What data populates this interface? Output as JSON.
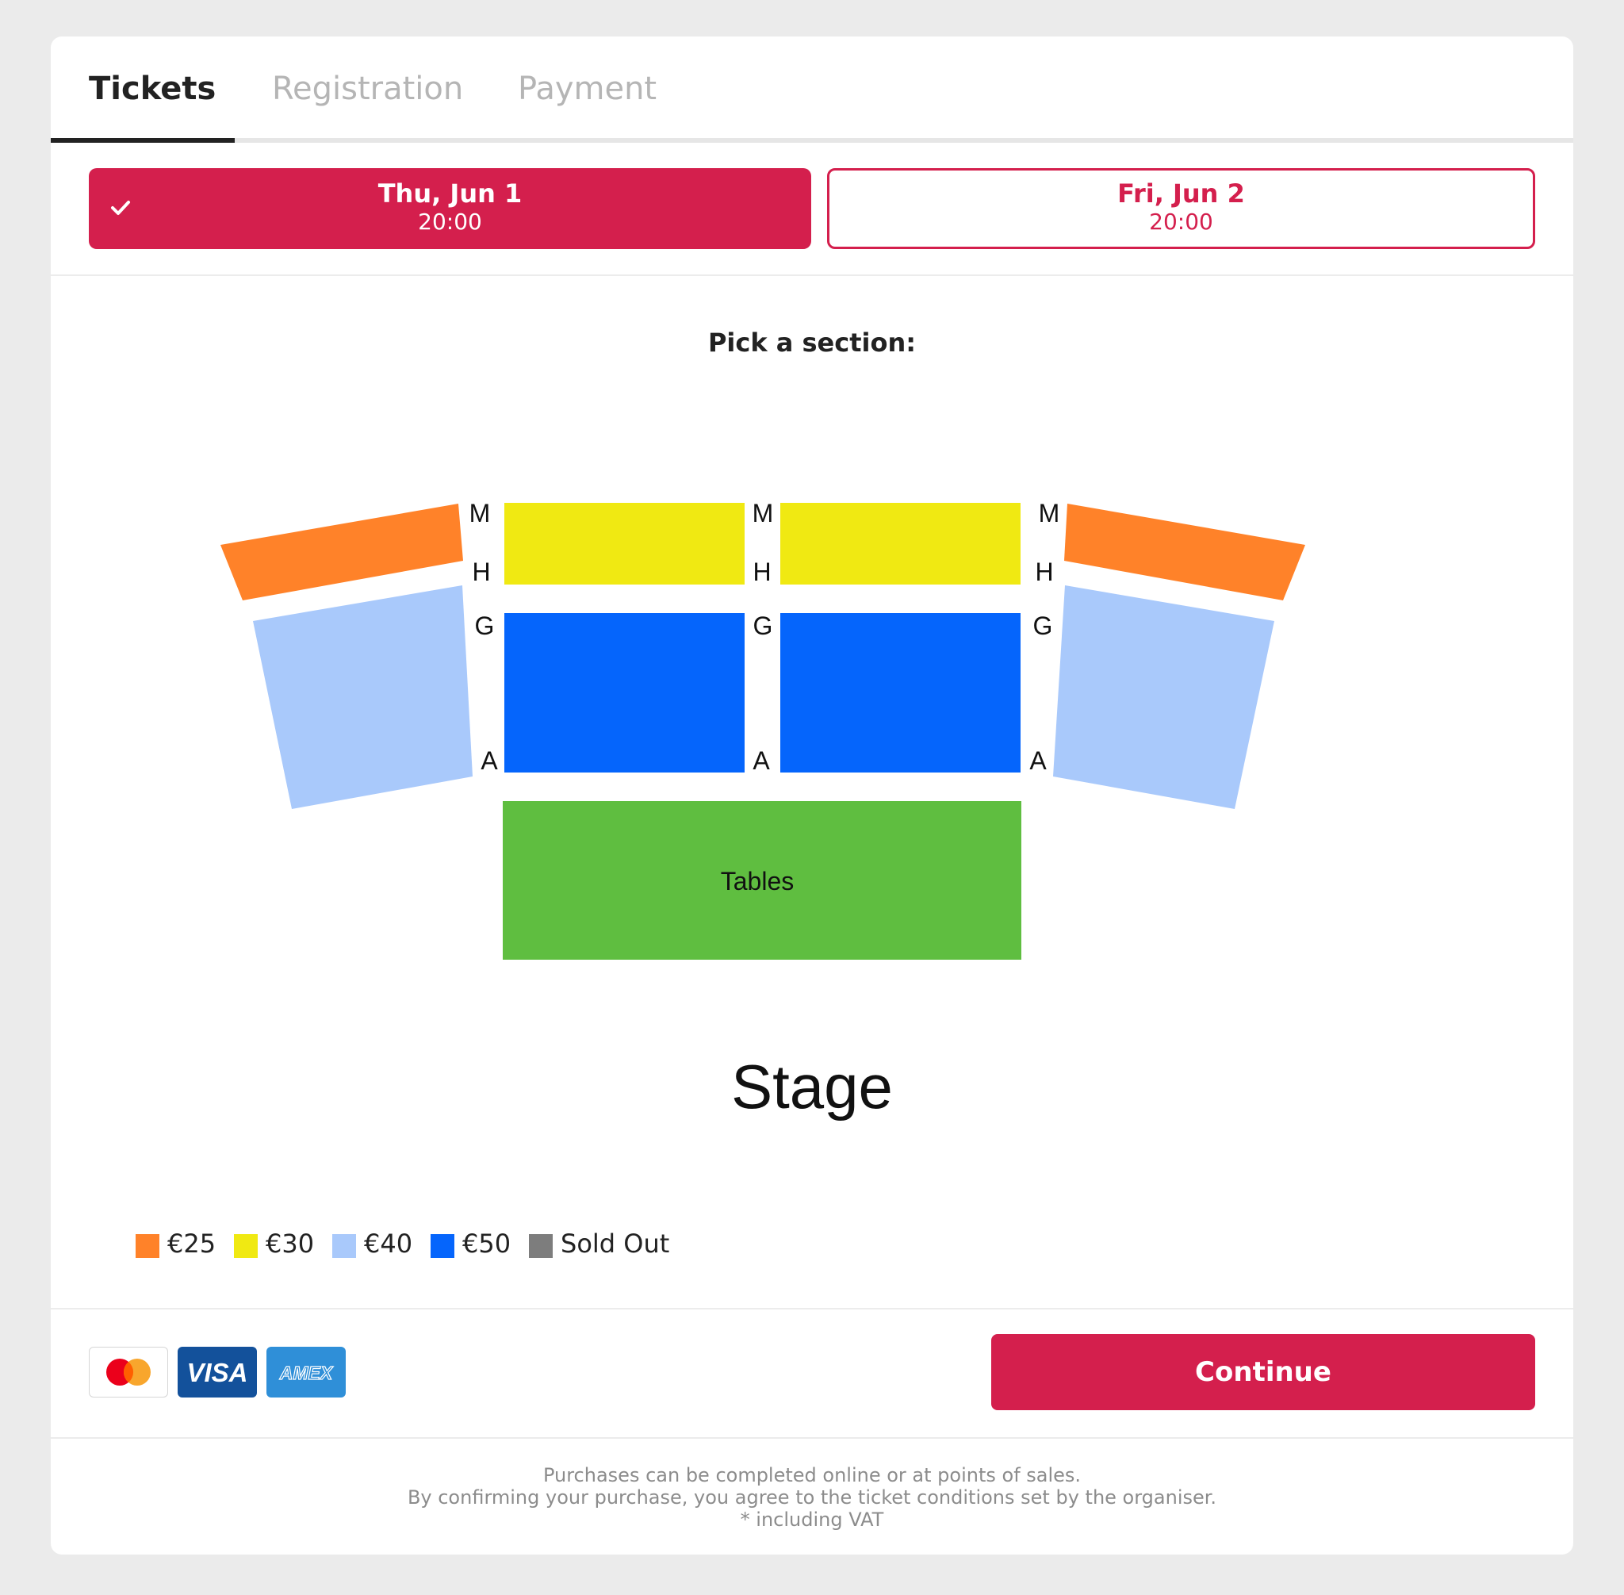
{
  "tabs": [
    {
      "label": "Tickets",
      "state": "active"
    },
    {
      "label": "Registration",
      "state": "inactive"
    },
    {
      "label": "Payment",
      "state": "inactive"
    }
  ],
  "dates": [
    {
      "day": "Thu, Jun 1",
      "time": "20:00",
      "selected": true
    },
    {
      "day": "Fri, Jun 2",
      "time": "20:00",
      "selected": false
    }
  ],
  "seatmap": {
    "prompt": "Pick a section:",
    "row_labels": {
      "m": "M",
      "h": "H",
      "g": "G",
      "a": "A"
    },
    "tables_label": "Tables",
    "stage_label": "Stage",
    "sections": [
      {
        "name": "left-upper",
        "price": "€25"
      },
      {
        "name": "center-left-upper",
        "price": "€30"
      },
      {
        "name": "center-right-upper",
        "price": "€30"
      },
      {
        "name": "right-upper",
        "price": "€25"
      },
      {
        "name": "left-lower",
        "price": "€40"
      },
      {
        "name": "center-left-lower",
        "price": "€50"
      },
      {
        "name": "center-right-lower",
        "price": "€50"
      },
      {
        "name": "right-lower",
        "price": "€40"
      },
      {
        "name": "tables",
        "price": ""
      }
    ]
  },
  "legend": [
    {
      "label": "€25",
      "color": "#ff8229"
    },
    {
      "label": "€30",
      "color": "#f0e912"
    },
    {
      "label": "€40",
      "color": "#a9c9fb"
    },
    {
      "label": "€50",
      "color": "#0565fc"
    },
    {
      "label": "Sold Out",
      "color": "#7d7d7d"
    }
  ],
  "colors": {
    "accent": "#d41f4d",
    "tables": "#5fbe40"
  },
  "payment": {
    "logos": [
      "mastercard-icon",
      "visa-icon",
      "amex-icon"
    ],
    "visa_text": "VISA",
    "amex_text": "AMEX"
  },
  "actions": {
    "continue_label": "Continue"
  },
  "footer": {
    "line1": "Purchases can be completed online or at points of sales.",
    "line2": "By confirming your purchase, you agree to the ticket conditions set by the organiser.",
    "line3": "* including VAT"
  }
}
